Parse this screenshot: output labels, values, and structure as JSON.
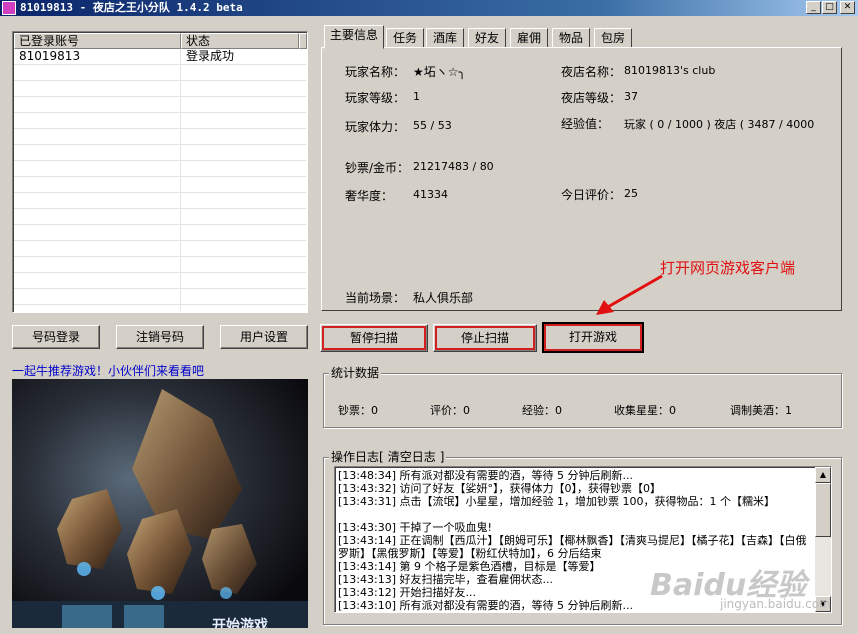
{
  "window": {
    "title": "81019813 - 夜店之王小分队 1.4.2 beta",
    "controls": {
      "minimize": "_",
      "maximize": "□",
      "close": "✕"
    }
  },
  "account_list": {
    "columns": [
      "已登录账号",
      "状态"
    ],
    "rows": [
      {
        "account": "81019813",
        "status": "登录成功"
      }
    ]
  },
  "buttons": {
    "login": "号码登录",
    "logout": "注销号码",
    "user_settings": "用户设置",
    "pause_scan": "暂停扫描",
    "stop_scan": "停止扫描",
    "open_game": "打开游戏"
  },
  "tabs": [
    "主要信息",
    "任务",
    "酒库",
    "好友",
    "雇佣",
    "物品",
    "包房"
  ],
  "main_info": {
    "player_name_label": "玩家名称：",
    "player_name": "★坧ヽ☆╮",
    "club_name_label": "夜店名称：",
    "club_name": "81019813's club",
    "player_level_label": "玩家等级：",
    "player_level": "1",
    "club_level_label": "夜店等级：",
    "club_level": "37",
    "stamina_label": "玩家体力：",
    "stamina": "55 / 53",
    "exp_label": "经验值：",
    "exp_value": "玩家 ( 0 / 1000 )  夜店 ( 3487 / 4000",
    "money_label": "钞票/金币：",
    "money": "21217483 / 80",
    "luxury_label": "奢华度：",
    "luxury": "41334",
    "rating_label": "今日评价：",
    "rating": "25",
    "scene_label": "当前场景：",
    "scene": "私人俱乐部"
  },
  "stats": {
    "title": "统计数据",
    "money": "钞票：0",
    "rating": "评价：0",
    "exp": "经验：0",
    "stars": "收集星星：0",
    "wine": "调制美酒：1"
  },
  "log": {
    "title": "操作日志[",
    "clear_label": "清空日志",
    "title_end": "]",
    "lines": [
      "[13:48:34]  所有派对都没有需要的酒，等待 5 分钟后刷新...",
      "[13:43:32]  访问了好友【娑妍°】，获得体力【0】，获得钞票【0】",
      "[13:43:31]  点击【流氓】小星星，增加经验 1，增加钞票 100，获得物品：1 个【糯米】",
      "[13:43:30]  干掉了一个吸血鬼!",
      "[13:43:14]  正在调制【西瓜汁】【朗姆可乐】【椰林飘香】【清爽马提尼】【橘子花】【吉森】【白俄罗斯】【黑俄罗斯】【等爱】【粉红伏特加】，6 分后结束",
      "[13:43:14]  第 9 个格子是紫色酒槽，目标是【等爱】",
      "[13:43:13]  好友扫描完毕，查看雇佣状态...",
      "[13:43:12]  开始扫描好友...",
      "[13:43:10]  所有派对都没有需要的酒，等待 5 分钟后刷新..."
    ]
  },
  "ad": {
    "link_text": "一起牛推荐游戏！小伙伴们来看看吧",
    "image_caption": "开始游戏"
  },
  "annotation": {
    "text": "打开网页游戏客户端",
    "color": "#e01010"
  },
  "watermark": {
    "logo": "Baidu经验",
    "url": "jingyan.baidu.com"
  }
}
